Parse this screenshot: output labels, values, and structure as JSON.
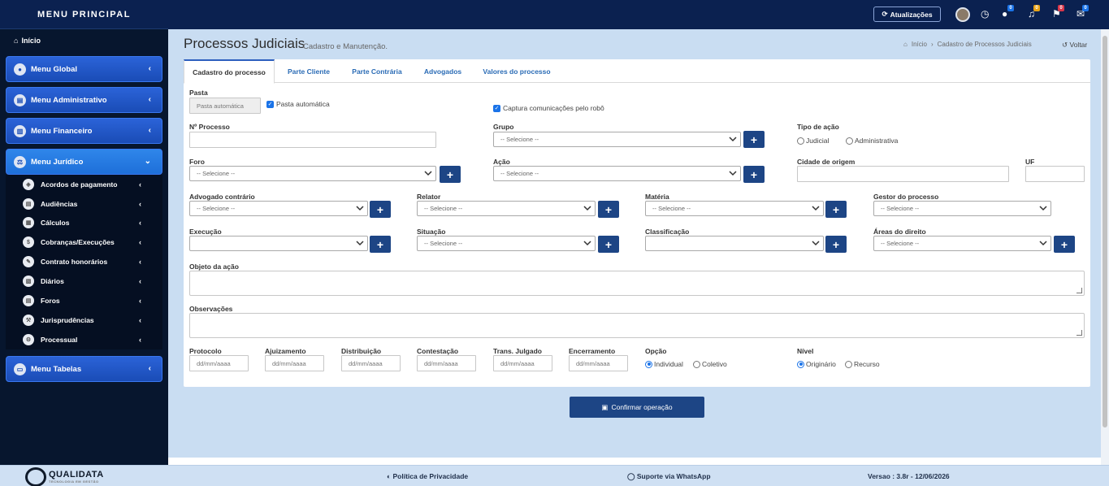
{
  "sidebar": {
    "title": "MENU PRINCIPAL",
    "home": "Início",
    "menus": {
      "global": "Menu Global",
      "admin": "Menu Administrativo",
      "fin": "Menu Financeiro",
      "jur": "Menu Jurídico",
      "tab": "Menu Tabelas"
    },
    "sub": {
      "s0": "Acordos de pagamento",
      "s1": "Audiências",
      "s2": "Cálculos",
      "s3": "Cobranças/Execuções",
      "s4": "Contrato honorários",
      "s5": "Diários",
      "s6": "Foros",
      "s7": "Jurisprudências",
      "s8": "Processual"
    }
  },
  "topbar": {
    "update_label": "Atualizações",
    "badges": {
      "b1": "0",
      "b2": "0",
      "b3": "0",
      "b4": "0",
      "b5": "0"
    }
  },
  "page": {
    "title": "Processos Judiciais",
    "subtitle": "Cadastro e Manutenção.",
    "crumb_home": "Início",
    "crumb_current": "Cadastro de Processos Judiciais",
    "back": "Voltar"
  },
  "tabs": {
    "t0": "Cadastro do processo",
    "t1": "Parte Cliente",
    "t2": "Parte Contrária",
    "t3": "Advogados",
    "t4": "Valores do processo"
  },
  "form": {
    "pasta_label": "Pasta",
    "pasta_value": "Pasta automática",
    "pasta_auto": "Pasta automática",
    "captura": "Captura comunicações pelo robô",
    "nprocesso": "Nº Processo",
    "grupo": "Grupo",
    "tipo_acao": "Tipo de ação",
    "judicial": "Judicial",
    "administrativa": "Administrativa",
    "foro": "Foro",
    "acao": "Ação",
    "cidade": "Cidade de origem",
    "uf": "UF",
    "advogado": "Advogado contrário",
    "relator": "Relator",
    "materia": "Matéria",
    "gestor": "Gestor do processo",
    "execucao": "Execução",
    "situacao": "Situação",
    "classificacao": "Classificação",
    "areas": "Áreas do direito",
    "objeto": "Objeto da ação",
    "observacoes": "Observações",
    "protocolo": "Protocolo",
    "ajuizamento": "Ajuizamento",
    "distribuicao": "Distribuição",
    "contestacao": "Contestação",
    "trans": "Trans. Julgado",
    "encerramento": "Encerramento",
    "opcao": "Opção",
    "individual": "Individual",
    "coletivo": "Coletivo",
    "nivel": "Nível",
    "originario": "Originário",
    "recurso": "Recurso",
    "select_ph": "-- Selecione --",
    "date_ph": "dd/mm/aaaa"
  },
  "confirm": "Confirmar operação",
  "footer": {
    "brand": "QUALIDATA",
    "brand_tag": "TECNOLOGIA EM GESTÃO",
    "privacy": "Política de Privacidade",
    "support": "Suporte via WhatsApp",
    "version": "Versao : 3.8r - 12/06/2026"
  },
  "colors": {
    "navy": "#0b2150",
    "sidebar": "#07162e",
    "accent": "#1d4585",
    "menu_blue": "#1a4cb6",
    "page_bg": "#c9ddf2"
  }
}
